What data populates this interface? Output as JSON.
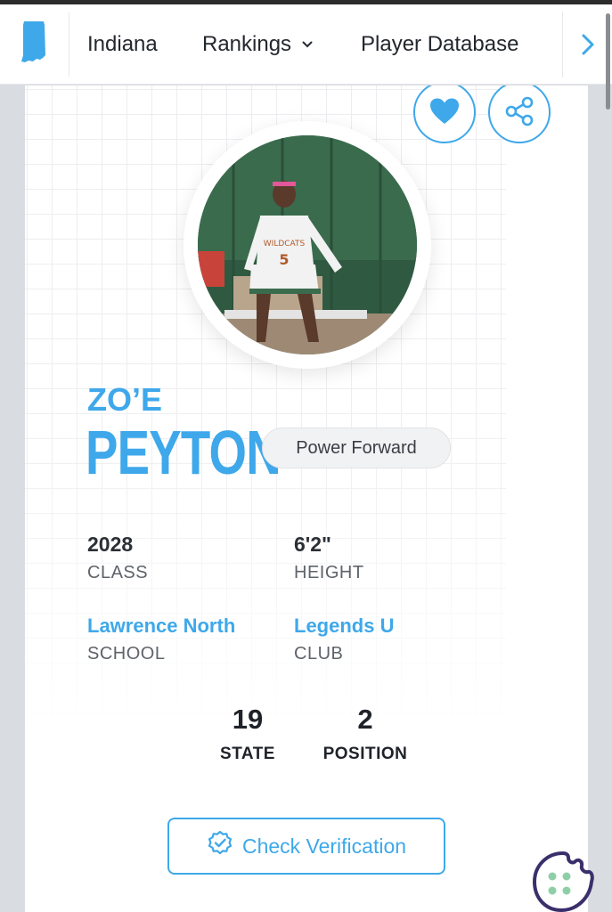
{
  "nav": {
    "logo_icon": "indiana-state-icon",
    "state": "Indiana",
    "rankings": "Rankings",
    "player_database": "Player Database",
    "next_icon": "chevron-right-icon"
  },
  "actions": {
    "favorite_icon": "heart-icon",
    "share_icon": "share-icon"
  },
  "player": {
    "first_name": "ZO’E",
    "last_name": "PEYTON",
    "position": "Power Forward",
    "class_value": "2028",
    "class_label": "CLASS",
    "height_value": "6'2\"",
    "height_label": "HEIGHT",
    "school_value": "Lawrence North",
    "school_label": "SCHOOL",
    "club_value": "Legends U",
    "club_label": "CLUB"
  },
  "rankings": {
    "state_value": "19",
    "state_label": "STATE",
    "position_value": "2",
    "position_label": "POSITION"
  },
  "verification": {
    "label": "Check Verification",
    "icon": "verified-badge-icon"
  },
  "cookie": {
    "icon": "cookie-icon"
  },
  "colors": {
    "accent": "#3ea8ea",
    "text_dark": "#2b2f36",
    "label_gray": "#5f636a"
  }
}
